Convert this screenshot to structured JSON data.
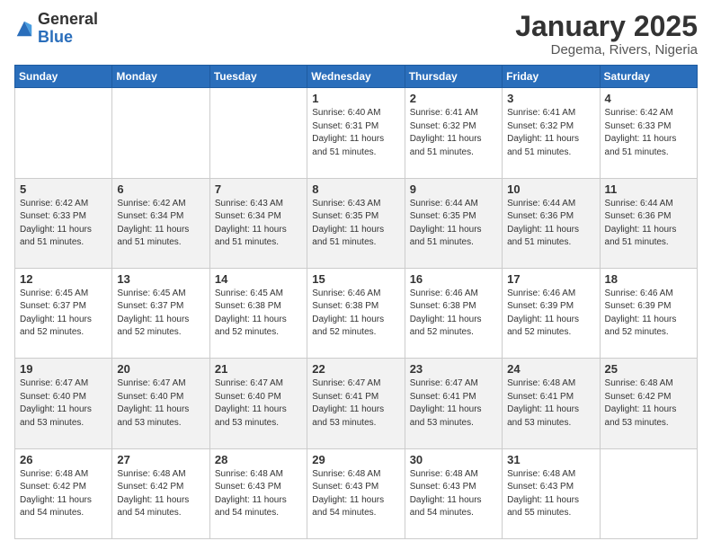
{
  "logo": {
    "general": "General",
    "blue": "Blue"
  },
  "title": "January 2025",
  "subtitle": "Degema, Rivers, Nigeria",
  "days_of_week": [
    "Sunday",
    "Monday",
    "Tuesday",
    "Wednesday",
    "Thursday",
    "Friday",
    "Saturday"
  ],
  "weeks": [
    [
      {
        "day": "",
        "info": ""
      },
      {
        "day": "",
        "info": ""
      },
      {
        "day": "",
        "info": ""
      },
      {
        "day": "1",
        "info": "Sunrise: 6:40 AM\nSunset: 6:31 PM\nDaylight: 11 hours\nand 51 minutes."
      },
      {
        "day": "2",
        "info": "Sunrise: 6:41 AM\nSunset: 6:32 PM\nDaylight: 11 hours\nand 51 minutes."
      },
      {
        "day": "3",
        "info": "Sunrise: 6:41 AM\nSunset: 6:32 PM\nDaylight: 11 hours\nand 51 minutes."
      },
      {
        "day": "4",
        "info": "Sunrise: 6:42 AM\nSunset: 6:33 PM\nDaylight: 11 hours\nand 51 minutes."
      }
    ],
    [
      {
        "day": "5",
        "info": "Sunrise: 6:42 AM\nSunset: 6:33 PM\nDaylight: 11 hours\nand 51 minutes."
      },
      {
        "day": "6",
        "info": "Sunrise: 6:42 AM\nSunset: 6:34 PM\nDaylight: 11 hours\nand 51 minutes."
      },
      {
        "day": "7",
        "info": "Sunrise: 6:43 AM\nSunset: 6:34 PM\nDaylight: 11 hours\nand 51 minutes."
      },
      {
        "day": "8",
        "info": "Sunrise: 6:43 AM\nSunset: 6:35 PM\nDaylight: 11 hours\nand 51 minutes."
      },
      {
        "day": "9",
        "info": "Sunrise: 6:44 AM\nSunset: 6:35 PM\nDaylight: 11 hours\nand 51 minutes."
      },
      {
        "day": "10",
        "info": "Sunrise: 6:44 AM\nSunset: 6:36 PM\nDaylight: 11 hours\nand 51 minutes."
      },
      {
        "day": "11",
        "info": "Sunrise: 6:44 AM\nSunset: 6:36 PM\nDaylight: 11 hours\nand 51 minutes."
      }
    ],
    [
      {
        "day": "12",
        "info": "Sunrise: 6:45 AM\nSunset: 6:37 PM\nDaylight: 11 hours\nand 52 minutes."
      },
      {
        "day": "13",
        "info": "Sunrise: 6:45 AM\nSunset: 6:37 PM\nDaylight: 11 hours\nand 52 minutes."
      },
      {
        "day": "14",
        "info": "Sunrise: 6:45 AM\nSunset: 6:38 PM\nDaylight: 11 hours\nand 52 minutes."
      },
      {
        "day": "15",
        "info": "Sunrise: 6:46 AM\nSunset: 6:38 PM\nDaylight: 11 hours\nand 52 minutes."
      },
      {
        "day": "16",
        "info": "Sunrise: 6:46 AM\nSunset: 6:38 PM\nDaylight: 11 hours\nand 52 minutes."
      },
      {
        "day": "17",
        "info": "Sunrise: 6:46 AM\nSunset: 6:39 PM\nDaylight: 11 hours\nand 52 minutes."
      },
      {
        "day": "18",
        "info": "Sunrise: 6:46 AM\nSunset: 6:39 PM\nDaylight: 11 hours\nand 52 minutes."
      }
    ],
    [
      {
        "day": "19",
        "info": "Sunrise: 6:47 AM\nSunset: 6:40 PM\nDaylight: 11 hours\nand 53 minutes."
      },
      {
        "day": "20",
        "info": "Sunrise: 6:47 AM\nSunset: 6:40 PM\nDaylight: 11 hours\nand 53 minutes."
      },
      {
        "day": "21",
        "info": "Sunrise: 6:47 AM\nSunset: 6:40 PM\nDaylight: 11 hours\nand 53 minutes."
      },
      {
        "day": "22",
        "info": "Sunrise: 6:47 AM\nSunset: 6:41 PM\nDaylight: 11 hours\nand 53 minutes."
      },
      {
        "day": "23",
        "info": "Sunrise: 6:47 AM\nSunset: 6:41 PM\nDaylight: 11 hours\nand 53 minutes."
      },
      {
        "day": "24",
        "info": "Sunrise: 6:48 AM\nSunset: 6:41 PM\nDaylight: 11 hours\nand 53 minutes."
      },
      {
        "day": "25",
        "info": "Sunrise: 6:48 AM\nSunset: 6:42 PM\nDaylight: 11 hours\nand 53 minutes."
      }
    ],
    [
      {
        "day": "26",
        "info": "Sunrise: 6:48 AM\nSunset: 6:42 PM\nDaylight: 11 hours\nand 54 minutes."
      },
      {
        "day": "27",
        "info": "Sunrise: 6:48 AM\nSunset: 6:42 PM\nDaylight: 11 hours\nand 54 minutes."
      },
      {
        "day": "28",
        "info": "Sunrise: 6:48 AM\nSunset: 6:43 PM\nDaylight: 11 hours\nand 54 minutes."
      },
      {
        "day": "29",
        "info": "Sunrise: 6:48 AM\nSunset: 6:43 PM\nDaylight: 11 hours\nand 54 minutes."
      },
      {
        "day": "30",
        "info": "Sunrise: 6:48 AM\nSunset: 6:43 PM\nDaylight: 11 hours\nand 54 minutes."
      },
      {
        "day": "31",
        "info": "Sunrise: 6:48 AM\nSunset: 6:43 PM\nDaylight: 11 hours\nand 55 minutes."
      },
      {
        "day": "",
        "info": ""
      }
    ]
  ]
}
